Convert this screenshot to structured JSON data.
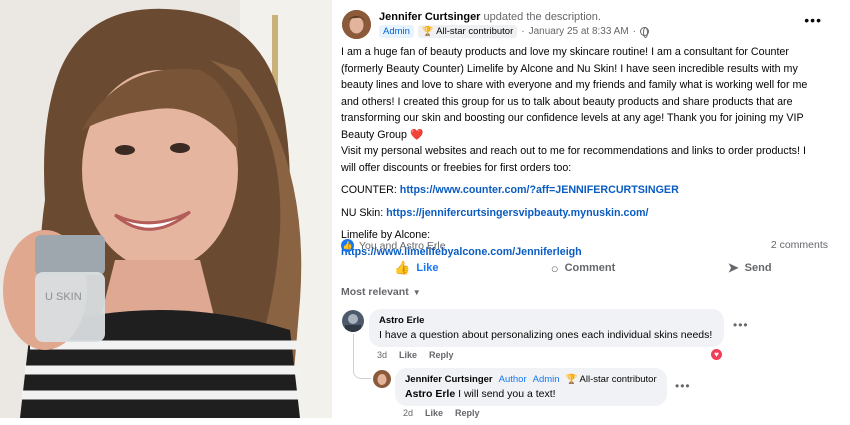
{
  "post": {
    "author": "Jennifer Curtsinger",
    "action_text": "updated the description.",
    "role_badge": "Admin",
    "contributor_badge": "All-star contributor",
    "timestamp": "January 25 at 8:33 AM",
    "separator": "·",
    "paragraph1": "I am a huge fan of beauty products and love my skincare routine! I am a consultant for Counter (formerly Beauty Counter) Limelife by Alcone and Nu Skin! I have seen incredible results with my beauty lines and love to share with everyone and my friends and family what is working well for me and others! I created this group for us to talk about beauty products and share products that are transforming our skin and boosting our confidence levels at any age! Thank you for joining my VIP Beauty Group",
    "heart": "❤️",
    "paragraph2": "Visit my personal websites and reach out to me for recommendations and links to order products! I will offer discounts or freebies for first orders too:",
    "counter_label": "COUNTER:",
    "counter_link": "https://www.counter.com/?aff=JENNIFERCURTSINGER",
    "nuskin_label": "NU Skin:",
    "nuskin_link": "https://jennifercurtsingersvipbeauty.mynuskin.com/",
    "limelife_label": "Limelife by Alcone:",
    "limelife_link": "https://www.limelifebyalcone.com/Jenniferleigh"
  },
  "stats": {
    "reactors": "You and Astro Erle",
    "comment_count": "2 comments"
  },
  "actions": {
    "like": "Like",
    "comment": "Comment",
    "send": "Send"
  },
  "sort": {
    "label": "Most relevant"
  },
  "comments": [
    {
      "author": "Astro Erle",
      "text": "I have a question about personalizing ones each individual skins needs!",
      "time": "3d",
      "like": "Like",
      "reply": "Reply"
    }
  ],
  "reply": {
    "author": "Jennifer Curtsinger",
    "author_tag": "Author",
    "admin_tag": "Admin",
    "contributor_tag": "All-star contributor",
    "mention": "Astro Erle",
    "text": "I will send you a text!",
    "time": "2d",
    "like": "Like",
    "reply": "Reply"
  },
  "icons": [
    "trophy-icon",
    "globe-icon",
    "more-icon",
    "like-icon",
    "comment-icon",
    "send-icon",
    "heart-icon",
    "caret-down-icon"
  ],
  "colors": {
    "link": "#0a5cc2",
    "like_blue": "#1877f2",
    "bubble": "#f0f2f5",
    "heart": "#e0343f"
  }
}
